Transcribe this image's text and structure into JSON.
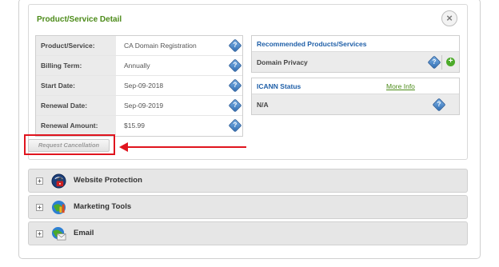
{
  "panel": {
    "title": "Product/Service Detail",
    "close_symbol": "×"
  },
  "details": [
    {
      "label": "Product/Service:",
      "value": "CA Domain Registration"
    },
    {
      "label": "Billing Term:",
      "value": "Annually"
    },
    {
      "label": "Start Date:",
      "value": "Sep-09-2018"
    },
    {
      "label": "Renewal Date:",
      "value": "Sep-09-2019"
    },
    {
      "label": "Renewal Amount:",
      "value": "$15.99"
    }
  ],
  "recommended": {
    "header": "Recommended Products/Services",
    "item": "Domain Privacy"
  },
  "icann": {
    "header": "ICANN Status",
    "more_info": "More Info",
    "value": "N/A"
  },
  "actions": {
    "cancel_label": "Request Cancellation"
  },
  "accordion": [
    {
      "label": "Website Protection",
      "icon": "shield-lock-icon"
    },
    {
      "label": "Marketing Tools",
      "icon": "globe-chart-icon"
    },
    {
      "label": "Email",
      "icon": "globe-envelope-icon"
    }
  ],
  "icons": {
    "help_glyph": "?",
    "add_glyph": "+",
    "expand_glyph": "+"
  },
  "colors": {
    "title_green": "#4c8b19",
    "link_blue": "#1f5fa8",
    "highlight_red": "#e0141e"
  }
}
